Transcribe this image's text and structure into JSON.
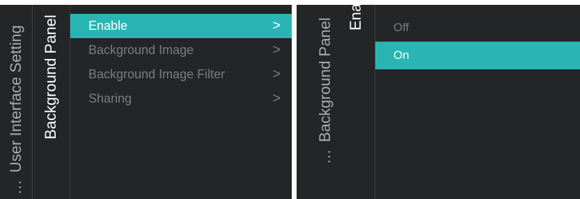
{
  "left_panel": {
    "breadcrumb_parent": "User Interface Setting",
    "breadcrumb_current": "Background Panel",
    "menu_items": [
      {
        "label": "Enable",
        "selected": true
      },
      {
        "label": "Background Image",
        "selected": false
      },
      {
        "label": "Background Image Filter",
        "selected": false
      },
      {
        "label": "Sharing",
        "selected": false
      }
    ]
  },
  "right_panel": {
    "breadcrumb_parent": "Background Panel",
    "breadcrumb_current": "Enable",
    "options": [
      {
        "label": "Off",
        "selected": false
      },
      {
        "label": "On",
        "selected": true
      }
    ]
  },
  "icons": {
    "more": "ellipsis-icon",
    "submenu": "chevron-right-icon"
  },
  "chevron_glyph": ">",
  "ellipsis_glyph": "…",
  "colors": {
    "panel_bg": "#232527",
    "accent": "#29b5b3",
    "text_active": "#ffffff",
    "text_inactive": "#7a7d80",
    "breadcrumb_text": "#a9abac"
  }
}
